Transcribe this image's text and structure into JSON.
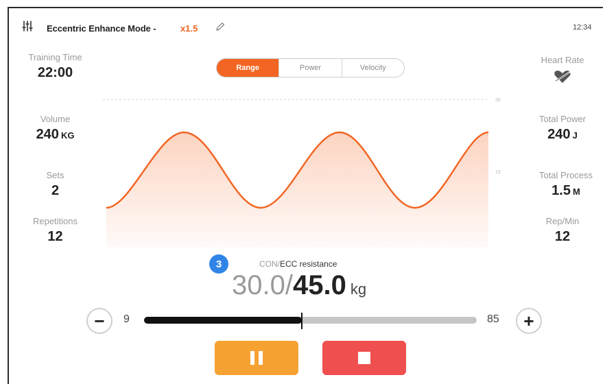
{
  "header": {
    "mode_title": "Eccentric Enhance Mode - ",
    "multiplier": "x1.5",
    "time": "12:34",
    "icons": {
      "settings": "sliders-icon",
      "edit": "pencil-icon"
    }
  },
  "left_stats": [
    {
      "label": "Training Time",
      "value": "22:00",
      "unit": ""
    },
    {
      "label": "Volume",
      "value": "240",
      "unit": "KG"
    },
    {
      "label": "Sets",
      "value": "2",
      "unit": ""
    },
    {
      "label": "Repetitions",
      "value": "12",
      "unit": ""
    }
  ],
  "right_stats": [
    {
      "label": "Heart Rate",
      "icon": "heart-broken-icon"
    },
    {
      "label": "Total Power",
      "value": "240",
      "unit": "J"
    },
    {
      "label": "Total Process",
      "value": "1.5",
      "unit": "M"
    },
    {
      "label": "Rep/Min",
      "value": "12",
      "unit": ""
    }
  ],
  "tabs": [
    {
      "label": "Range",
      "active": true
    },
    {
      "label": "Power",
      "active": false
    },
    {
      "label": "Velocity",
      "active": false
    }
  ],
  "chart_data": {
    "type": "line",
    "title": "",
    "y_tick_labels": [
      "30",
      "15"
    ],
    "series_color": "#f26522"
  },
  "resistance": {
    "set_number": "3",
    "label_con": "CON/",
    "label_ecc": "ECC resistance",
    "con_value": "30.0/",
    "ecc_value": "45.0",
    "unit": "kg"
  },
  "slider": {
    "min_label": "9",
    "max_label": "85",
    "minus_label": "−",
    "plus_label": "+",
    "value": 45
  },
  "colors": {
    "accent": "#f26522",
    "pause": "#f6a233",
    "stop": "#ef4f4f",
    "badge": "#2f84e6"
  }
}
